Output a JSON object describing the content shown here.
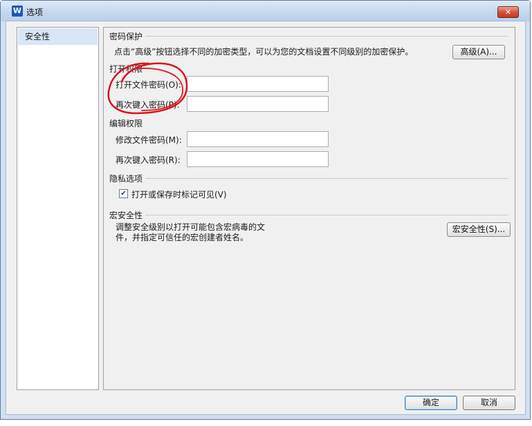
{
  "window": {
    "title": "选项",
    "app_icon_letter": "W",
    "close_label": "✕"
  },
  "nav": {
    "items": [
      {
        "label": "安全性",
        "selected": true
      }
    ]
  },
  "password_protection": {
    "title": "密码保护",
    "description": "点击“高级”按钮选择不同的加密类型，可以为您的文档设置不同级别的加密保护。",
    "advanced_button": "高级(A)..."
  },
  "open_permission": {
    "title": "打开权限",
    "open_password_label": "打开文件密码(O):",
    "reenter_label": "再次键入密码(P):",
    "open_password_value": "",
    "reenter_value": ""
  },
  "edit_permission": {
    "title": "编辑权限",
    "modify_password_label": "修改文件密码(M):",
    "reenter_label": "再次键入密码(R):",
    "modify_password_value": "",
    "reenter_value": ""
  },
  "privacy": {
    "title": "隐私选项",
    "checkbox_label": "打开或保存时标记可见(V)",
    "checked": true
  },
  "macro_security": {
    "title": "宏安全性",
    "description_line1": "调整安全级别以打开可能包含宏病毒的文",
    "description_line2": "件，并指定可信任的宏创建者姓名。",
    "button": "宏安全性(S)..."
  },
  "footer": {
    "ok": "确定",
    "cancel": "取消"
  },
  "colors": {
    "annotation": "#d9141e",
    "selected_nav": "#d8e6f7",
    "title_bar": "#c3d7ee"
  }
}
